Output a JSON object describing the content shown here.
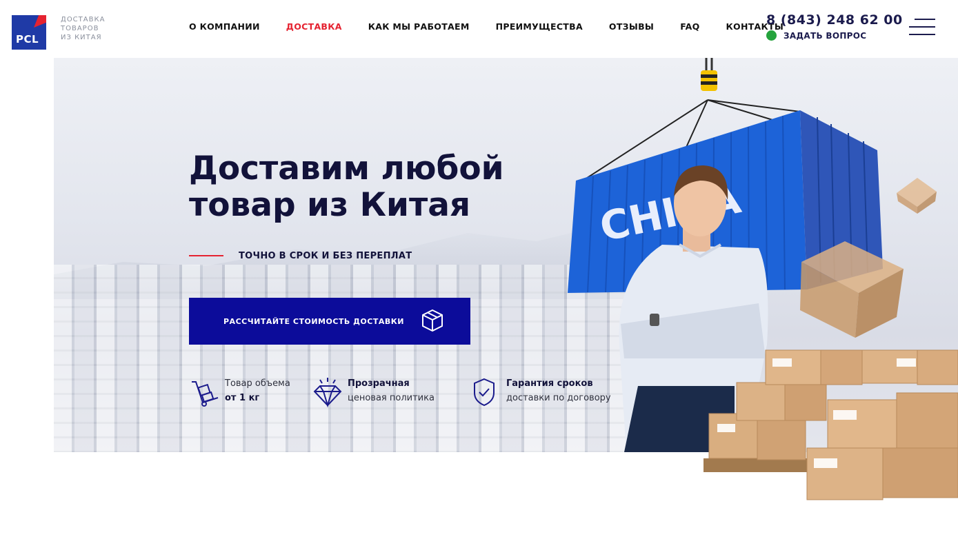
{
  "header": {
    "logo_text": "PCL",
    "logo_caption": [
      "ДОСТАВКА",
      "ТОВАРОВ",
      "ИЗ КИТАЯ"
    ],
    "nav": [
      "О КОМПАНИИ",
      "ДОСТАВКА",
      "КАК МЫ РАБОТАЕМ",
      "ПРЕИМУЩЕСТВА",
      "ОТЗЫВЫ",
      "FAQ",
      "КОНТАКТЫ"
    ],
    "active_nav": "ДОСТАВКА",
    "phone": "8 (843) 248 62 00",
    "ask_label": "ЗАДАТЬ ВОПРОС",
    "menu_icon": "hamburger-menu-icon"
  },
  "hero": {
    "title_line1": "Доставим любой",
    "title_line2": "товар из Китая",
    "tagline": "ТОЧНО В СРОК И БЕЗ ПЕРЕПЛАТ",
    "cta_label": "РАССЧИТАЙТЕ СТОИМОСТЬ ДОСТАВКИ",
    "cta_icon": "box-icon",
    "container_text": "CHINA"
  },
  "features": [
    {
      "icon": "hand-truck-icon",
      "line1": "Товар объема",
      "line2": "от 1 кг"
    },
    {
      "icon": "diamond-icon",
      "line1": "Прозрачная",
      "line2": "ценовая политика"
    },
    {
      "icon": "shield-check-icon",
      "line1": "Гарантия сроков",
      "line2": "доставки по договору"
    }
  ],
  "colors": {
    "brand_blue": "#0c0c9a",
    "logo_blue": "#1f3aa6",
    "accent_red": "#e52230",
    "online_green": "#25a33d",
    "dark_text": "#12123a"
  }
}
